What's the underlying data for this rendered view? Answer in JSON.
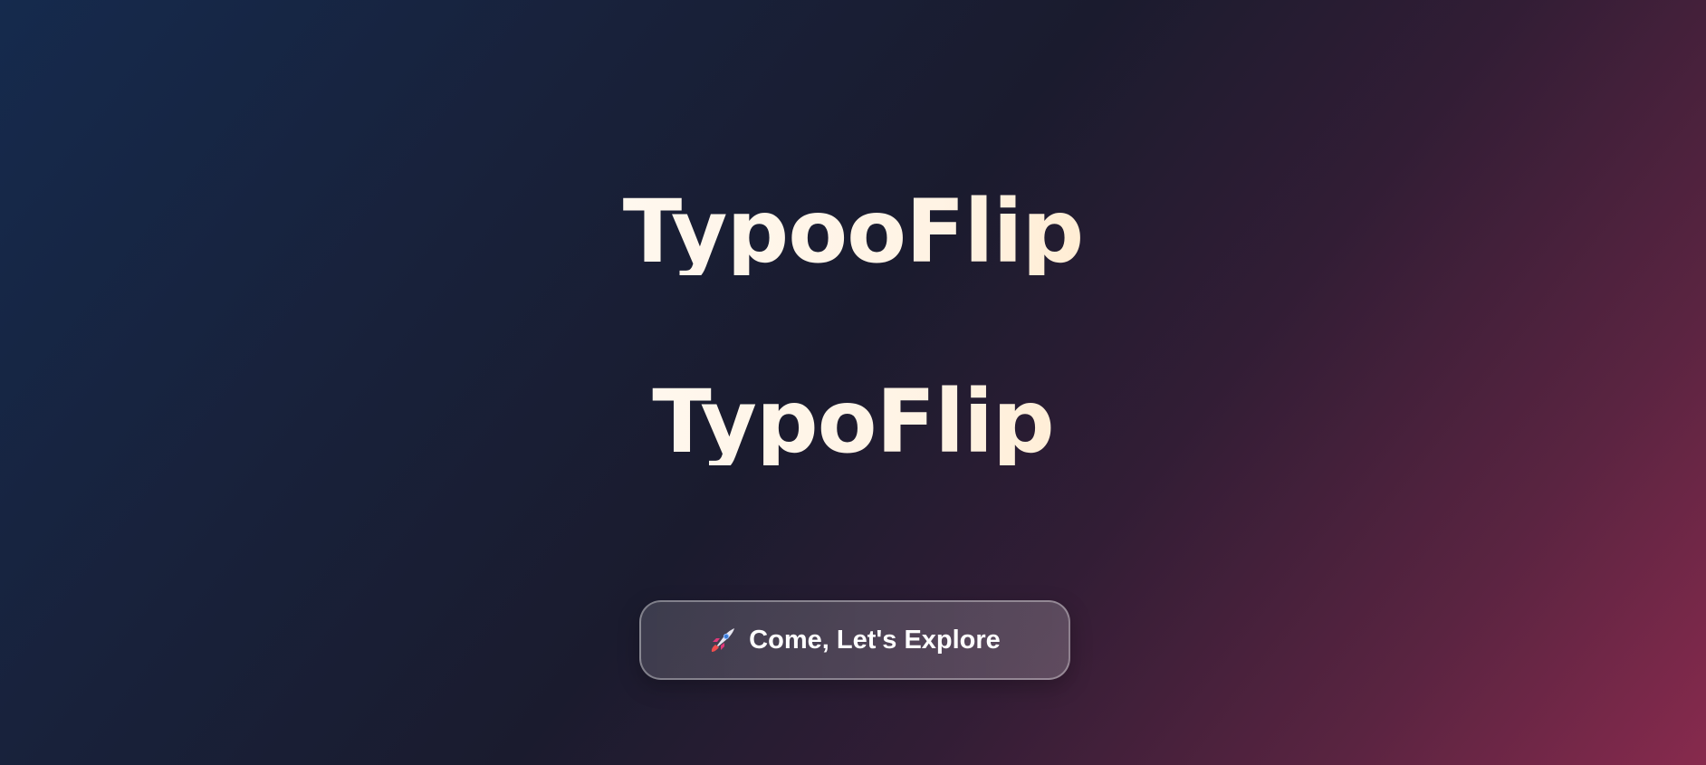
{
  "hero": {
    "title_primary": "TypooFlip",
    "title_secondary": "TypoFlip"
  },
  "cta": {
    "icon": "rocket-icon",
    "label": "Come, Let's Explore"
  },
  "colors": {
    "background_start": "#152a4d",
    "background_mid": "#1a1b2e",
    "background_end": "#872a4d",
    "title_gradient_start": "#ffe9c8",
    "title_gradient_end": "#ffd28e"
  }
}
